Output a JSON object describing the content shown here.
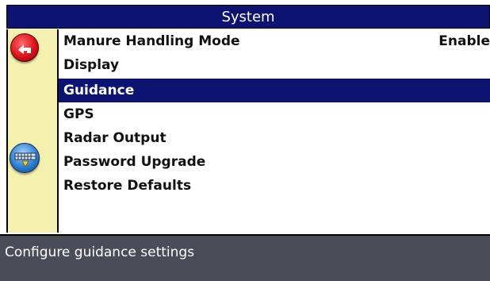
{
  "header": {
    "title": "System"
  },
  "sidebar": {
    "back_icon": "back-arrow-icon",
    "gps_icon": "satellite-icon",
    "back_color": "#d8121a",
    "gps_color": "#2f7fd0"
  },
  "menu": {
    "items": [
      {
        "label": "Manure Handling Mode",
        "value": "Enable"
      },
      {
        "label": "Display",
        "value": ""
      },
      {
        "label": "Guidance",
        "value": "",
        "selected": true
      },
      {
        "label": "GPS",
        "value": ""
      },
      {
        "label": "Radar Output",
        "value": ""
      },
      {
        "label": "Password Upgrade",
        "value": ""
      },
      {
        "label": "Restore Defaults",
        "value": ""
      }
    ]
  },
  "status": {
    "text": "Configure guidance settings"
  },
  "colors": {
    "title_bar": "#0d1370",
    "selection": "#0d1370",
    "sidebar": "#f3f0b0",
    "status_bar": "#4a4d57"
  }
}
